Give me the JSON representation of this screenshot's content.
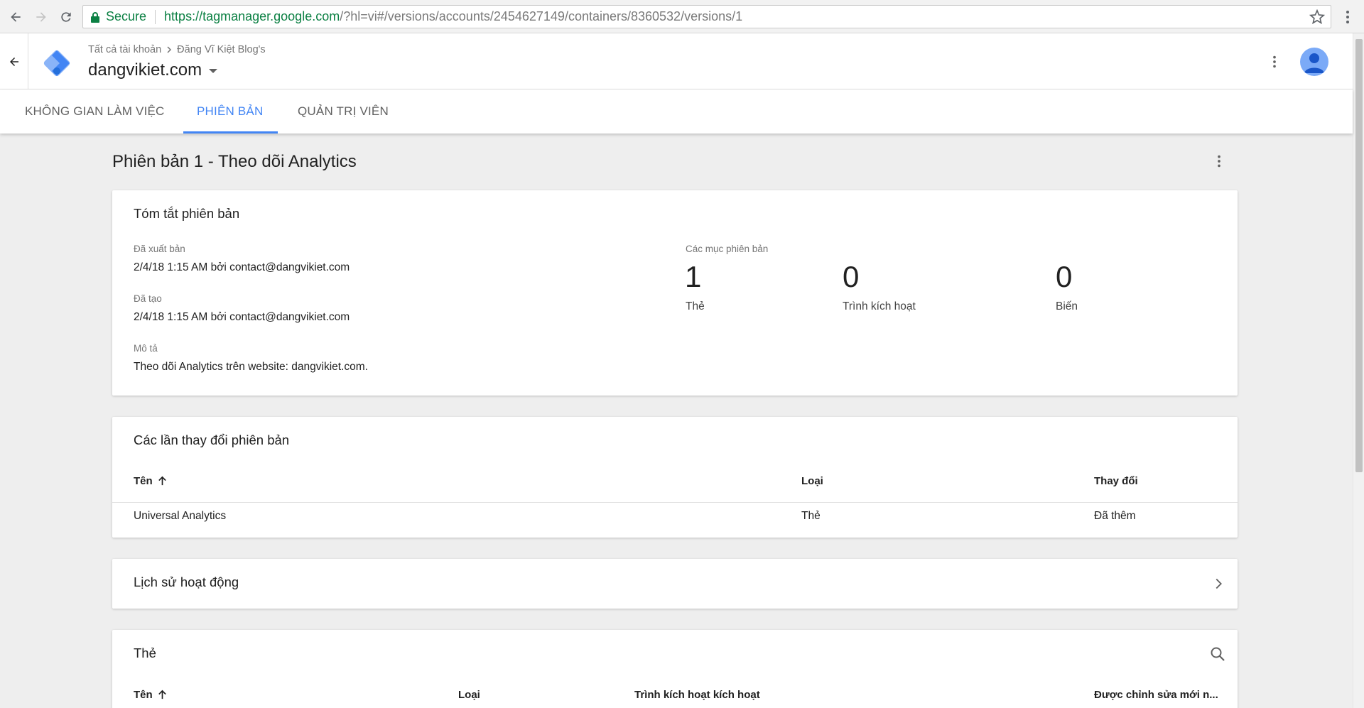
{
  "browser": {
    "secure_label": "Secure",
    "url_host": "https://tagmanager.google.com",
    "url_rest": "/?hl=vi#/versions/accounts/2454627149/containers/8360532/versions/1"
  },
  "header": {
    "breadcrumb_root": "Tất cả tài khoản",
    "breadcrumb_account": "Đăng Vĩ Kiệt Blog's",
    "container_name": "dangvikiet.com"
  },
  "tabs": [
    {
      "label": "KHÔNG GIAN LÀM VIỆC"
    },
    {
      "label": "PHIÊN BẢN"
    },
    {
      "label": "QUẢN TRỊ VIÊN"
    }
  ],
  "page": {
    "title": "Phiên bản 1 - Theo dõi Analytics"
  },
  "summary": {
    "title": "Tóm tắt phiên bản",
    "published_label": "Đã xuất bản",
    "published_value": "2/4/18 1:15 AM bởi contact@dangvikiet.com",
    "created_label": "Đã tạo",
    "created_value": "2/4/18 1:15 AM bởi contact@dangvikiet.com",
    "description_label": "Mô tả",
    "description_value": "Theo dõi Analytics trên website: dangvikiet.com.",
    "items_label": "Các mục phiên bản",
    "counts": [
      {
        "value": "1",
        "label": "Thẻ"
      },
      {
        "value": "0",
        "label": "Trình kích hoạt"
      },
      {
        "value": "0",
        "label": "Biến"
      }
    ]
  },
  "changes": {
    "title": "Các lần thay đổi phiên bản",
    "columns": [
      "Tên",
      "Loại",
      "Thay đổi"
    ],
    "rows": [
      {
        "name": "Universal Analytics",
        "type": "Thẻ",
        "change": "Đã thêm"
      }
    ]
  },
  "activity": {
    "title": "Lịch sử hoạt động"
  },
  "tags": {
    "title": "Thẻ",
    "columns": [
      "Tên",
      "Loại",
      "Trình kích hoạt kích hoạt",
      "Được chỉnh sửa mới n..."
    ]
  },
  "colors": {
    "accent": "#4285f4",
    "secure": "#0b8043",
    "background": "#eeeeee"
  }
}
